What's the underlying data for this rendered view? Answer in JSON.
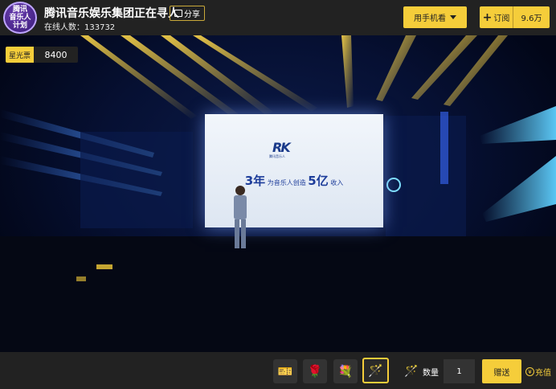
{
  "header": {
    "logo_lines": [
      "腾讯",
      "音乐人",
      "计划"
    ],
    "title": "腾讯音乐娱乐集团正在寻人",
    "online": "在线人数：133732",
    "share_label": "分享",
    "phone_watch_label": "用手机看",
    "subscribe_label": "订阅",
    "subscribe_count": "9.6万"
  },
  "stage": {
    "star_ticket_label": "星光票",
    "star_ticket_value": "8400",
    "screen": {
      "logo_text": "RK",
      "logo_sub": "腾讯音乐人",
      "slogan_num1": "3年",
      "slogan_mid": " 为音乐人创造 ",
      "slogan_num2": "5亿",
      "slogan_end": " 收入"
    }
  },
  "footer": {
    "gifts": [
      {
        "name": "gift-badge",
        "glyph": "🎫",
        "selected": false
      },
      {
        "name": "gift-roses",
        "glyph": "🌹",
        "selected": false
      },
      {
        "name": "gift-bouquet",
        "glyph": "💐",
        "selected": false
      },
      {
        "name": "gift-glowstick",
        "glyph": "🪄",
        "selected": true
      }
    ],
    "selected_gift_glyph": "🪄",
    "quantity_label": "数量",
    "quantity_value": "1",
    "send_label": "赠送",
    "recharge_label": "充值"
  },
  "colors": {
    "accent": "#f5cd3a",
    "bar_bg": "#222222"
  }
}
